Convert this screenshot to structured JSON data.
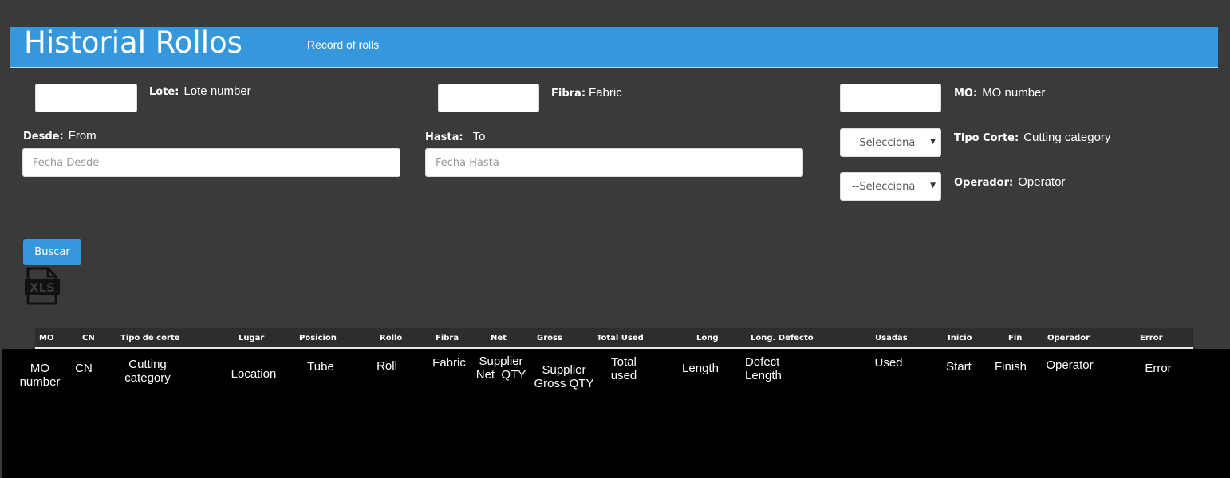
{
  "header": {
    "title": "Historial Rollos",
    "subtitle": "Record of rolls"
  },
  "filters": {
    "lote": {
      "label": "Lote:",
      "hint": "Lote number",
      "value": ""
    },
    "fibra": {
      "label": "Fibra:",
      "hint": "Fabric",
      "value": ""
    },
    "mo": {
      "label": "MO:",
      "hint": "MO number",
      "value": ""
    },
    "desde": {
      "label": "Desde:",
      "hint": "From",
      "placeholder": "Fecha Desde"
    },
    "hasta": {
      "label": "Hasta:",
      "hint": "To",
      "placeholder": "Fecha Hasta"
    },
    "tipo_corte": {
      "label": "Tipo Corte:",
      "hint": "Cutting category",
      "selected": "--Selecciona"
    },
    "operador": {
      "label": "Operador:",
      "hint": "Operator",
      "selected": "--Selecciona"
    }
  },
  "search_button": "Buscar",
  "export_icon": "xls-file-icon",
  "table": {
    "headers": [
      "MO",
      "CN",
      "Tipo de corte",
      "Lugar",
      "Posicion",
      "Rollo",
      "Fibra",
      "Net",
      "Gross",
      "Total Used",
      "Long",
      "Long. Defecto",
      "Usadas",
      "Inicio",
      "Fin",
      "Operador",
      "Error"
    ],
    "translations": [
      "MO\nnumber",
      "CN",
      "Cutting\ncategory",
      "Location",
      "Tube",
      "Roll",
      "Fabric",
      "Supplier\nNet  QTY",
      "Supplier\nGross QTY",
      "Total\nused",
      "Length",
      "Defect\nLength",
      "Used",
      "Start",
      "Finish",
      "Operator",
      "Error"
    ]
  },
  "colors": {
    "accent": "#3598dc",
    "background": "#3a3a3a",
    "table_body": "#000000"
  }
}
